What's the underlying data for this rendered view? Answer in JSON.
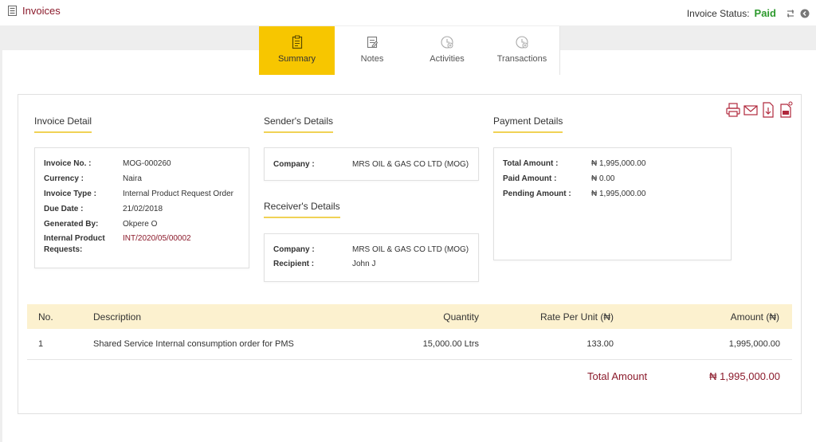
{
  "header": {
    "title": "Invoices",
    "status_label": "Invoice Status:",
    "status_value": "Paid",
    "status_color": "#2e9a2e",
    "brand_color": "#8b1a2b"
  },
  "tabs": [
    {
      "label": "Summary",
      "icon": "clipboard-icon",
      "active": true
    },
    {
      "label": "Notes",
      "icon": "notes-icon",
      "active": false
    },
    {
      "label": "Activities",
      "icon": "clock-plus-icon",
      "active": false
    },
    {
      "label": "Transactions",
      "icon": "clock-plus-icon",
      "active": false
    }
  ],
  "invoice_detail": {
    "title": "Invoice Detail",
    "fields": [
      {
        "label": "Invoice No. :",
        "value": "MOG-000260"
      },
      {
        "label": "Currency :",
        "value": "Naira"
      },
      {
        "label": "Invoice Type :",
        "value": "Internal Product Request Order"
      },
      {
        "label": "Due Date :",
        "value": "21/02/2018"
      },
      {
        "label": "Generated By:",
        "value": "Okpere O"
      },
      {
        "label": "Internal Product Requests:",
        "value": "INT/2020/05/00002"
      }
    ]
  },
  "sender": {
    "title": "Sender's Details",
    "company_label": "Company :",
    "company_value": "MRS OIL & GAS CO LTD (MOG)"
  },
  "receiver": {
    "title": "Receiver's Details",
    "company_label": "Company :",
    "company_value": "MRS OIL & GAS CO LTD (MOG)",
    "recipient_label": "Recipient :",
    "recipient_value": "John J"
  },
  "payment": {
    "title": "Payment Details",
    "fields": [
      {
        "label": "Total Amount :",
        "value": "₦ 1,995,000.00"
      },
      {
        "label": "Paid Amount :",
        "value": "₦ 0.00"
      },
      {
        "label": "Pending Amount :",
        "value": "₦ 1,995,000.00"
      }
    ]
  },
  "toolbar": [
    "print-icon",
    "email-icon",
    "download-icon",
    "pdf-icon"
  ],
  "table": {
    "headers": {
      "no": "No.",
      "description": "Description",
      "quantity": "Quantity",
      "rate": "Rate Per Unit (₦)",
      "amount": "Amount (₦)"
    },
    "rows": [
      {
        "no": "1",
        "description": "Shared Service Internal consumption order for PMS",
        "quantity": "15,000.00 Ltrs",
        "rate": "133.00",
        "amount": "1,995,000.00"
      }
    ],
    "total_label": "Total Amount",
    "total_value": "₦ 1,995,000.00"
  }
}
